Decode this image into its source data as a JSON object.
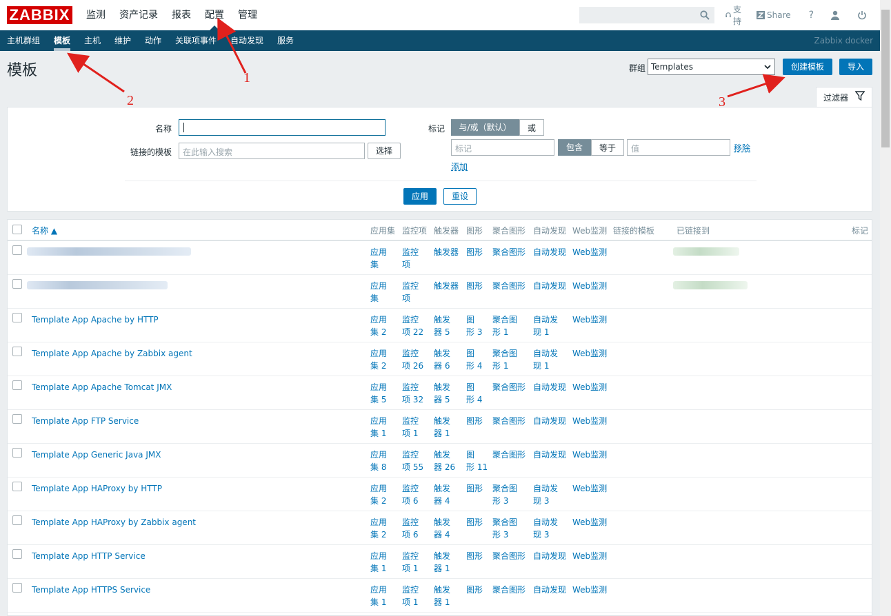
{
  "logo": "ZABBIX",
  "main_menu": [
    "监测",
    "资产记录",
    "报表",
    "配置",
    "管理"
  ],
  "top_actions": {
    "support": "支持",
    "share": "Share",
    "help": "?"
  },
  "sub_menu": [
    "主机群组",
    "模板",
    "主机",
    "维护",
    "动作",
    "关联项事件",
    "自动发现",
    "服务"
  ],
  "server_name": "Zabbix docker",
  "page_title": "模板",
  "group_label": "群组",
  "group_value": "Templates",
  "create_button": "创建模板",
  "import_button": "导入",
  "filter": {
    "tab_label": "过滤器",
    "name_label": "名称",
    "linked_label": "链接的模板",
    "linked_placeholder": "在此输入搜索",
    "select_button": "选择",
    "tags_label": "标记",
    "and_or": "与/或（默认）",
    "or": "或",
    "tag_placeholder": "标记",
    "contains": "包含",
    "equals": "等于",
    "value_placeholder": "值",
    "remove": "移除",
    "add": "添加",
    "apply": "应用",
    "reset": "重设"
  },
  "table": {
    "headers": {
      "name": "名称 ▲",
      "applications": "应用集",
      "items": "监控项",
      "triggers": "触发器",
      "graphs": "图形",
      "screens": "聚合图形",
      "discovery": "自动发现",
      "web": "Web监测",
      "linked": "链接的模板",
      "linked_to": "已链接到",
      "tags": "标记"
    },
    "rows": [
      {
        "name": "",
        "app": [
          "应用",
          "集"
        ],
        "items": [
          "监控",
          "项"
        ],
        "triggers": [
          "触发器"
        ],
        "graphs": [
          "图形"
        ],
        "screens": [
          "聚合图形"
        ],
        "discovery": [
          "自动发现"
        ],
        "web": "Web监测"
      },
      {
        "name": "",
        "app": [
          "应用",
          "集"
        ],
        "items": [
          "监控",
          "项"
        ],
        "triggers": [
          "触发器"
        ],
        "graphs": [
          "图形"
        ],
        "screens": [
          "聚合图形"
        ],
        "discovery": [
          "自动发现"
        ],
        "web": "Web监测"
      },
      {
        "name": "Template App Apache by HTTP",
        "app": [
          "应用",
          "集 2"
        ],
        "items": [
          "监控",
          "项 22"
        ],
        "triggers": [
          "触发",
          "器 5"
        ],
        "graphs": [
          "图",
          "形 3"
        ],
        "screens": [
          "聚合图",
          "形 1"
        ],
        "discovery": [
          "自动发",
          "现 1"
        ],
        "web": "Web监测"
      },
      {
        "name": "Template App Apache by Zabbix agent",
        "app": [
          "应用",
          "集 2"
        ],
        "items": [
          "监控",
          "项 26"
        ],
        "triggers": [
          "触发",
          "器 6"
        ],
        "graphs": [
          "图",
          "形 4"
        ],
        "screens": [
          "聚合图",
          "形 1"
        ],
        "discovery": [
          "自动发",
          "现 1"
        ],
        "web": "Web监测"
      },
      {
        "name": "Template App Apache Tomcat JMX",
        "app": [
          "应用",
          "集 5"
        ],
        "items": [
          "监控",
          "项 32"
        ],
        "triggers": [
          "触发",
          "器 5"
        ],
        "graphs": [
          "图",
          "形 4"
        ],
        "screens": [
          "聚合图形"
        ],
        "discovery": [
          "自动发现"
        ],
        "web": "Web监测"
      },
      {
        "name": "Template App FTP Service",
        "app": [
          "应用",
          "集 1"
        ],
        "items": [
          "监控",
          "项 1"
        ],
        "triggers": [
          "触发",
          "器 1"
        ],
        "graphs": [
          "图形"
        ],
        "screens": [
          "聚合图形"
        ],
        "discovery": [
          "自动发现"
        ],
        "web": "Web监测"
      },
      {
        "name": "Template App Generic Java JMX",
        "app": [
          "应用",
          "集 8"
        ],
        "items": [
          "监控",
          "项 55"
        ],
        "triggers": [
          "触发",
          "器 26"
        ],
        "graphs": [
          "图",
          "形 11"
        ],
        "screens": [
          "聚合图形"
        ],
        "discovery": [
          "自动发现"
        ],
        "web": "Web监测"
      },
      {
        "name": "Template App HAProxy by HTTP",
        "app": [
          "应用",
          "集 2"
        ],
        "items": [
          "监控",
          "项 6"
        ],
        "triggers": [
          "触发",
          "器 4"
        ],
        "graphs": [
          "图形"
        ],
        "screens": [
          "聚合图",
          "形 3"
        ],
        "discovery": [
          "自动发",
          "现 3"
        ],
        "web": "Web监测"
      },
      {
        "name": "Template App HAProxy by Zabbix agent",
        "app": [
          "应用",
          "集 2"
        ],
        "items": [
          "监控",
          "项 6"
        ],
        "triggers": [
          "触发",
          "器 4"
        ],
        "graphs": [
          "图形"
        ],
        "screens": [
          "聚合图",
          "形 3"
        ],
        "discovery": [
          "自动发",
          "现 3"
        ],
        "web": "Web监测"
      },
      {
        "name": "Template App HTTP Service",
        "app": [
          "应用",
          "集 1"
        ],
        "items": [
          "监控",
          "项 1"
        ],
        "triggers": [
          "触发",
          "器 1"
        ],
        "graphs": [
          "图形"
        ],
        "screens": [
          "聚合图形"
        ],
        "discovery": [
          "自动发现"
        ],
        "web": "Web监测"
      },
      {
        "name": "Template App HTTPS Service",
        "app": [
          "应用",
          "集 1"
        ],
        "items": [
          "监控",
          "项 1"
        ],
        "triggers": [
          "触发",
          "器 1"
        ],
        "graphs": [
          "图形"
        ],
        "screens": [
          "聚合图形"
        ],
        "discovery": [
          "自动发现"
        ],
        "web": "Web监测"
      }
    ]
  },
  "annotations": [
    "1",
    "2",
    "3"
  ],
  "colors": {
    "brand": "#d40000",
    "nav": "#0e4d6c",
    "link": "#0275b8",
    "annotation": "#e0211d"
  }
}
